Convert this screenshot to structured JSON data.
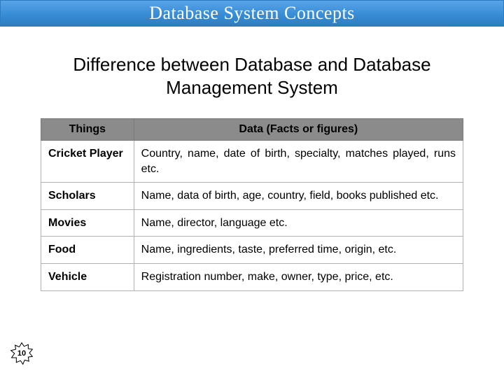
{
  "titlebar": {
    "text": "Database System Concepts"
  },
  "heading": "Difference between Database and Database Management System",
  "table": {
    "headers": {
      "col1": "Things",
      "col2": "Data (Facts or figures)"
    },
    "rows": [
      {
        "thing": "Cricket Player",
        "data": "Country, name, date of birth, specialty, matches played, runs etc."
      },
      {
        "thing": "Scholars",
        "data": "Name, data of birth, age, country, field, books published etc."
      },
      {
        "thing": "Movies",
        "data": "Name, director, language etc."
      },
      {
        "thing": "Food",
        "data": "Name, ingredients, taste, preferred time, origin, etc."
      },
      {
        "thing": "Vehicle",
        "data": "Registration number, make, owner, type, price, etc."
      }
    ]
  },
  "page_number": "10"
}
